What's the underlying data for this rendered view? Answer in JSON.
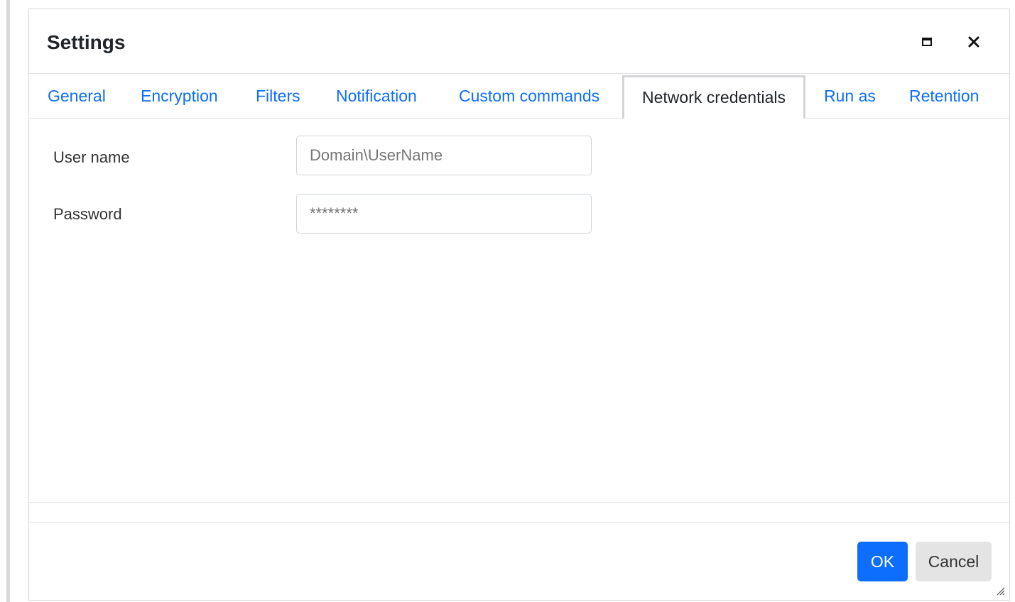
{
  "dialog": {
    "title": "Settings",
    "maximize_icon": "maximize-icon",
    "close_icon": "close-icon",
    "close_glyph": "✕"
  },
  "tabs": [
    {
      "label": "General",
      "active": false
    },
    {
      "label": "Encryption",
      "active": false
    },
    {
      "label": "Filters",
      "active": false
    },
    {
      "label": "Notification",
      "active": false
    },
    {
      "label": "Custom commands",
      "active": false
    },
    {
      "label": "Network credentials",
      "active": true
    },
    {
      "label": "Run as",
      "active": false
    },
    {
      "label": "Retention",
      "active": false
    }
  ],
  "form": {
    "user_name": {
      "label": "User name",
      "value": "",
      "placeholder": "Domain\\UserName"
    },
    "password": {
      "label": "Password",
      "value": "",
      "placeholder": "********"
    }
  },
  "footer": {
    "ok_label": "OK",
    "cancel_label": "Cancel"
  },
  "colors": {
    "accent": "#0d6efd",
    "tab_link": "#0d6efd",
    "active_tab_border": "#d4d4d4",
    "cancel_bg": "#e4e4e4"
  }
}
